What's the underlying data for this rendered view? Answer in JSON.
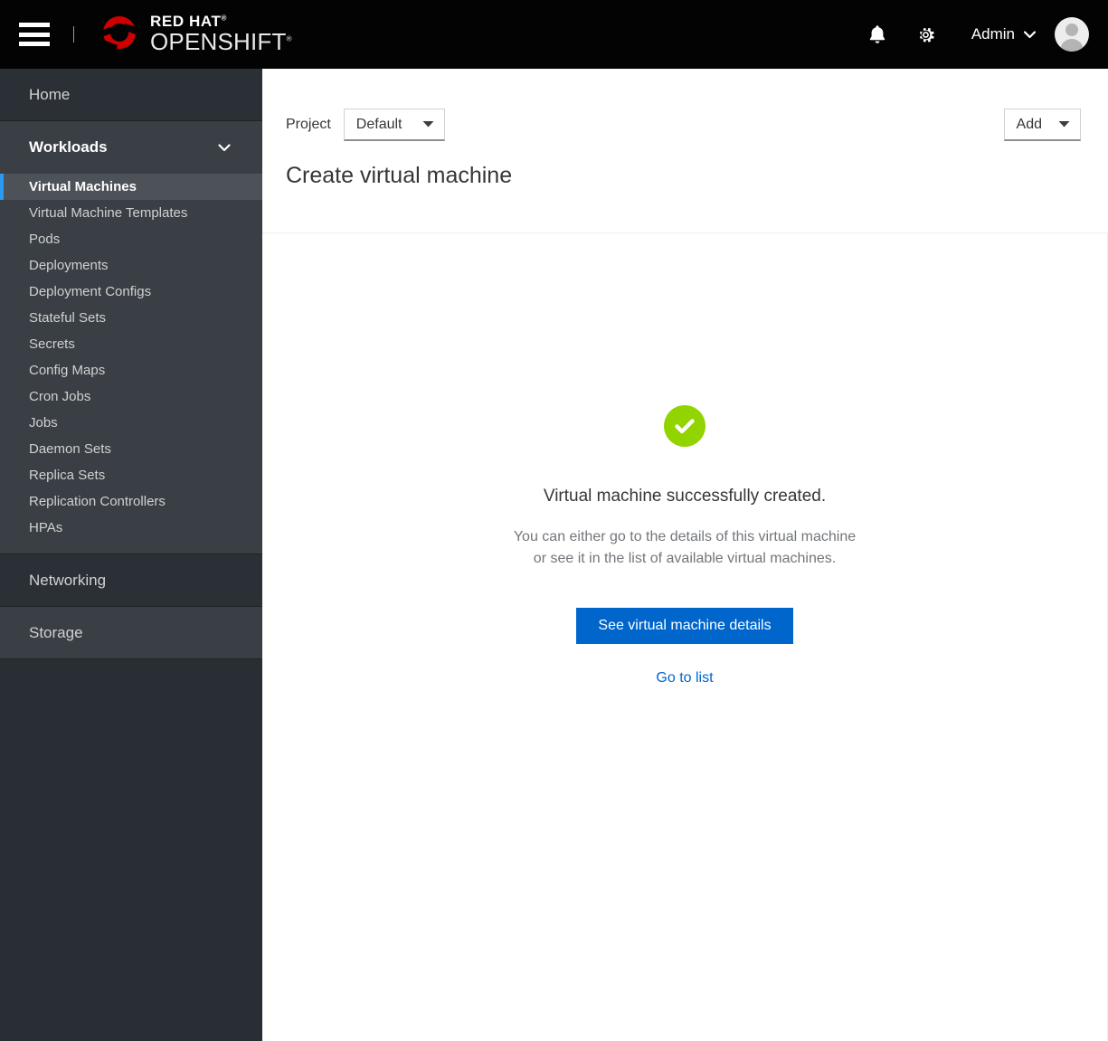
{
  "masthead": {
    "hamburger_icon": "hamburger-menu-icon",
    "brand": {
      "line1": "RED HAT",
      "line2": "OPENSHIFT",
      "trademark": "®",
      "logo_icon": "red-hat-logo-icon"
    },
    "notifications_icon": "bell-icon",
    "settings_icon": "gear-icon",
    "user_name": "Admin",
    "user_caret_icon": "chevron-down-icon",
    "avatar_icon": "user-avatar-icon"
  },
  "sidebar": {
    "home": {
      "label": "Home"
    },
    "workloads": {
      "label": "Workloads",
      "chevron_icon": "chevron-down-icon",
      "items": [
        {
          "label": "Virtual Machines",
          "active": true
        },
        {
          "label": "Virtual Machine Templates",
          "active": false
        },
        {
          "label": "Pods",
          "active": false
        },
        {
          "label": "Deployments",
          "active": false
        },
        {
          "label": "Deployment Configs",
          "active": false
        },
        {
          "label": "Stateful Sets",
          "active": false
        },
        {
          "label": "Secrets",
          "active": false
        },
        {
          "label": "Config Maps",
          "active": false
        },
        {
          "label": "Cron Jobs",
          "active": false
        },
        {
          "label": "Jobs",
          "active": false
        },
        {
          "label": "Daemon Sets",
          "active": false
        },
        {
          "label": "Replica Sets",
          "active": false
        },
        {
          "label": "Replication Controllers",
          "active": false
        },
        {
          "label": "HPAs",
          "active": false
        }
      ]
    },
    "networking": {
      "label": "Networking"
    },
    "storage": {
      "label": "Storage"
    }
  },
  "page_header": {
    "project_label": "Project",
    "project_value": "Default",
    "project_caret_icon": "caret-down-icon",
    "add_label": "Add",
    "add_caret_icon": "caret-down-icon",
    "title": "Create virtual machine"
  },
  "success": {
    "icon": "check-circle-icon",
    "title": "Virtual machine successfully created.",
    "description_line1": "You can either go to the details of this virtual machine",
    "description_line2": "or see it in the list of available virtual machines.",
    "primary_button": "See virtual machine details",
    "secondary_link": "Go to list"
  },
  "colors": {
    "masthead_bg": "#030303",
    "sidebar_bg": "#292e34",
    "sidebar_section_bg": "#393f44",
    "sidebar_active_bg": "#4d5258",
    "sidebar_active_accent": "#2b9af3",
    "brand_red": "#cc0000",
    "success_green": "#92d400",
    "primary_blue": "#0066cc",
    "link_blue": "#0066cc",
    "text_dark": "#363636",
    "text_muted": "#72767b"
  }
}
